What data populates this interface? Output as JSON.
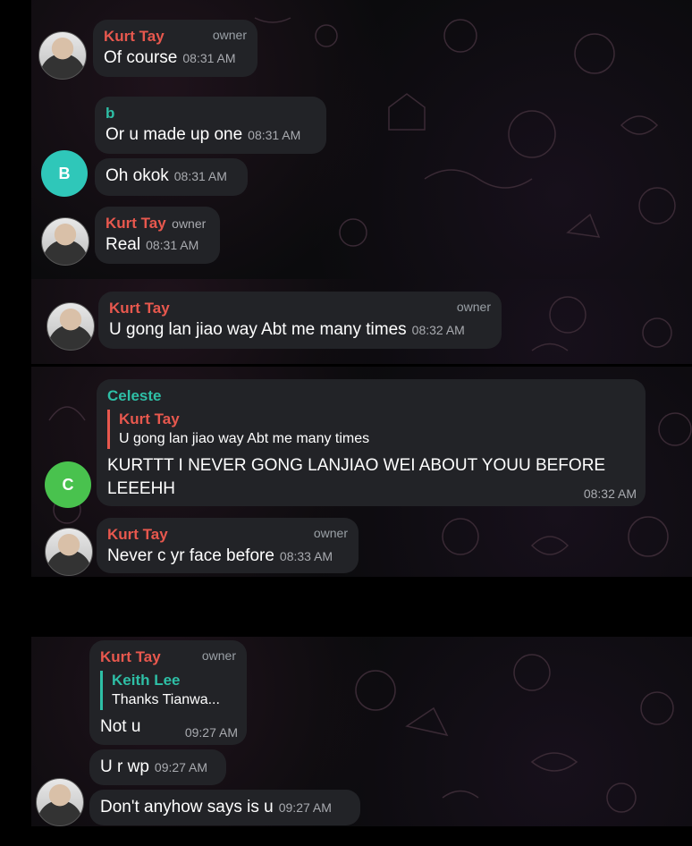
{
  "messages": {
    "m1": {
      "name": "Kurt Tay",
      "tag": "owner",
      "text": "Of course",
      "time": "08:31 AM"
    },
    "m2": {
      "name": "b",
      "text": "Or u made up one",
      "time": "08:31 AM"
    },
    "m3": {
      "text": "Oh okok",
      "time": "08:31 AM",
      "avatar_letter": "B"
    },
    "m4": {
      "name": "Kurt Tay",
      "tag": "owner",
      "text": "Real",
      "time": "08:31 AM"
    },
    "m5": {
      "name": "Kurt Tay",
      "tag": "owner",
      "text": "U gong lan jiao way Abt me many times",
      "time": "08:32 AM"
    },
    "m6": {
      "name": "Celeste",
      "reply_name": "Kurt Tay",
      "reply_text": "U gong lan jiao way Abt me many times",
      "text": "KURTTT I NEVER GONG LANJIAO WEI ABOUT YOUU BEFORE LEEEHH",
      "time": "08:32 AM",
      "avatar_letter": "C"
    },
    "m7": {
      "name": "Kurt Tay",
      "tag": "owner",
      "text": "Never c yr face before",
      "time": "08:33 AM"
    },
    "m8": {
      "name": "Kurt Tay",
      "tag": "owner",
      "reply_name": "Keith Lee",
      "reply_text": "Thanks Tianwa...",
      "text": "Not u",
      "time": "09:27 AM"
    },
    "m9": {
      "text": "U r wp",
      "time": "09:27 AM"
    },
    "m10": {
      "text": "Don't anyhow says is u",
      "time": "09:27 AM"
    }
  },
  "colors": {
    "owner_name": "#e8584e",
    "teal_name": "#2ebfa6",
    "bubble": "#222327",
    "avatar_b": "#2fc7b9",
    "avatar_c": "#49c24e"
  }
}
